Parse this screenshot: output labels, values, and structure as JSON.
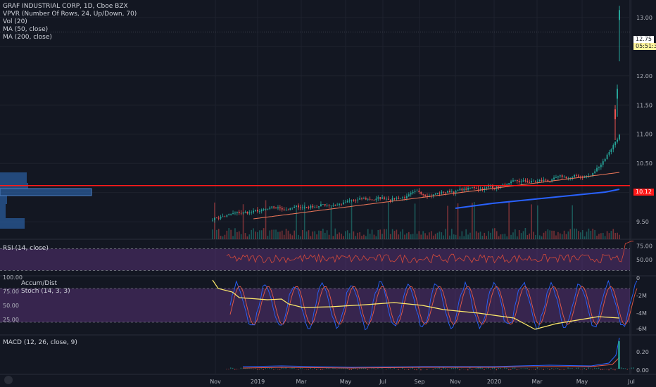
{
  "chart_data": [
    {
      "type": "candlestick",
      "title": "GRAF INDUSTRIAL CORP, 1D, Cboe BZX",
      "indicators": [
        "VPVR (Number Of Rows, 24, Up/Down, 70)",
        "Vol (20)",
        "MA (50, close)",
        "MA (200, close)"
      ],
      "ylim": [
        9.2,
        13.3
      ],
      "y_ticks": [
        "13.00",
        "12.50",
        "12.00",
        "11.50",
        "11.00",
        "10.50",
        "10.00",
        "9.50"
      ],
      "last_price": "12.75",
      "countdown": "05:51:39",
      "horizontal_line": "10.12",
      "x_ticks": [
        "Nov",
        "2019",
        "Mar",
        "May",
        "Jul",
        "Sep",
        "Nov",
        "2020",
        "Mar",
        "May",
        "Jul"
      ],
      "colors": {
        "up": "#26a69a",
        "down": "#ef5350",
        "ma50": "#f0785a",
        "ma200": "#2962ff",
        "hline": "#ff1a1a",
        "vpvr": "#2a5b9a"
      }
    },
    {
      "type": "line",
      "title": "RSI (14, close)",
      "ylim": [
        20,
        85
      ],
      "y_ticks": [
        "75.00",
        "50.00"
      ],
      "bands": [
        30,
        70
      ]
    },
    {
      "type": "line",
      "title": "Accum/Dist",
      "subtitle": "Stoch (14, 3, 3)",
      "left_ticks": [
        "100.00",
        "75.00",
        "50.00",
        "25.00"
      ],
      "right_ticks": [
        "0",
        "-2M",
        "-4M",
        "-6M"
      ]
    },
    {
      "type": "line",
      "title": "MACD (12, 26, close, 9)",
      "y_ticks": [
        "0.20",
        "0.00"
      ]
    }
  ]
}
